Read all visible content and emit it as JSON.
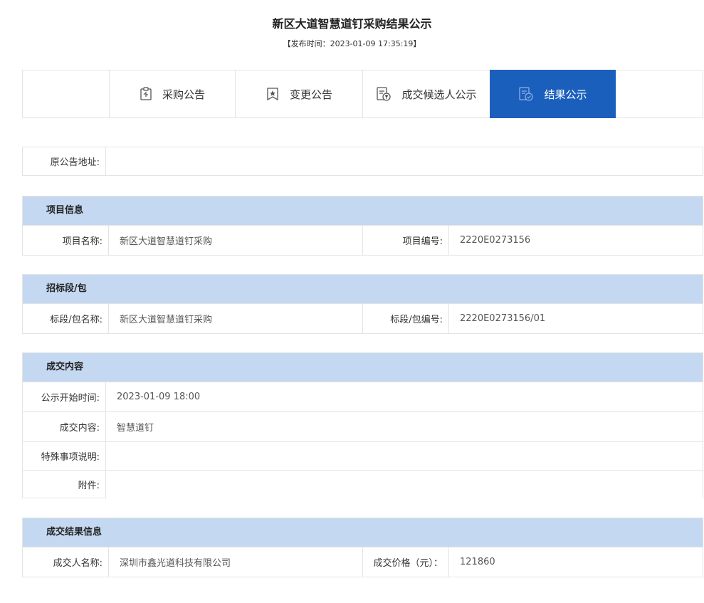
{
  "header": {
    "title": "新区大道智慧道钉采购结果公示",
    "publish_time": "【发布时间：2023-01-09 17:35:19】"
  },
  "tabs": [
    {
      "label": "采购公告",
      "icon": "clipboard-icon",
      "active": false
    },
    {
      "label": "变更公告",
      "icon": "bookmark-star-icon",
      "active": false
    },
    {
      "label": "成交候选人公示",
      "icon": "document-seal-icon",
      "active": false
    },
    {
      "label": "结果公示",
      "icon": "document-check-icon",
      "active": true
    }
  ],
  "original_notice": {
    "label": "原公告地址:",
    "value": ""
  },
  "project_info": {
    "heading": "项目信息",
    "name_label": "项目名称:",
    "name_value": "新区大道智慧道钉采购",
    "code_label": "项目编号:",
    "code_value": "2220E0273156"
  },
  "section_package": {
    "heading": "招标段/包",
    "name_label": "标段/包名称:",
    "name_value": "新区大道智慧道钉采购",
    "code_label": "标段/包编号:",
    "code_value": "2220E0273156/01"
  },
  "deal_content": {
    "heading": "成交内容",
    "start_label": "公示开始时间:",
    "start_value": "2023-01-09 18:00",
    "content_label": "成交内容:",
    "content_value": "智慧道钉",
    "special_label": "特殊事项说明:",
    "special_value": "",
    "attach_label": "附件:",
    "attach_value": ""
  },
  "deal_result": {
    "heading": "成交结果信息",
    "winner_label": "成交人名称:",
    "winner_value": "深圳市鑫光道科技有限公司",
    "price_label": "成交价格（元）：",
    "price_value": "121860"
  },
  "colors": {
    "accent": "#1b5fbd",
    "section_bg": "#c5d8f1",
    "border": "#e4e4e4"
  }
}
